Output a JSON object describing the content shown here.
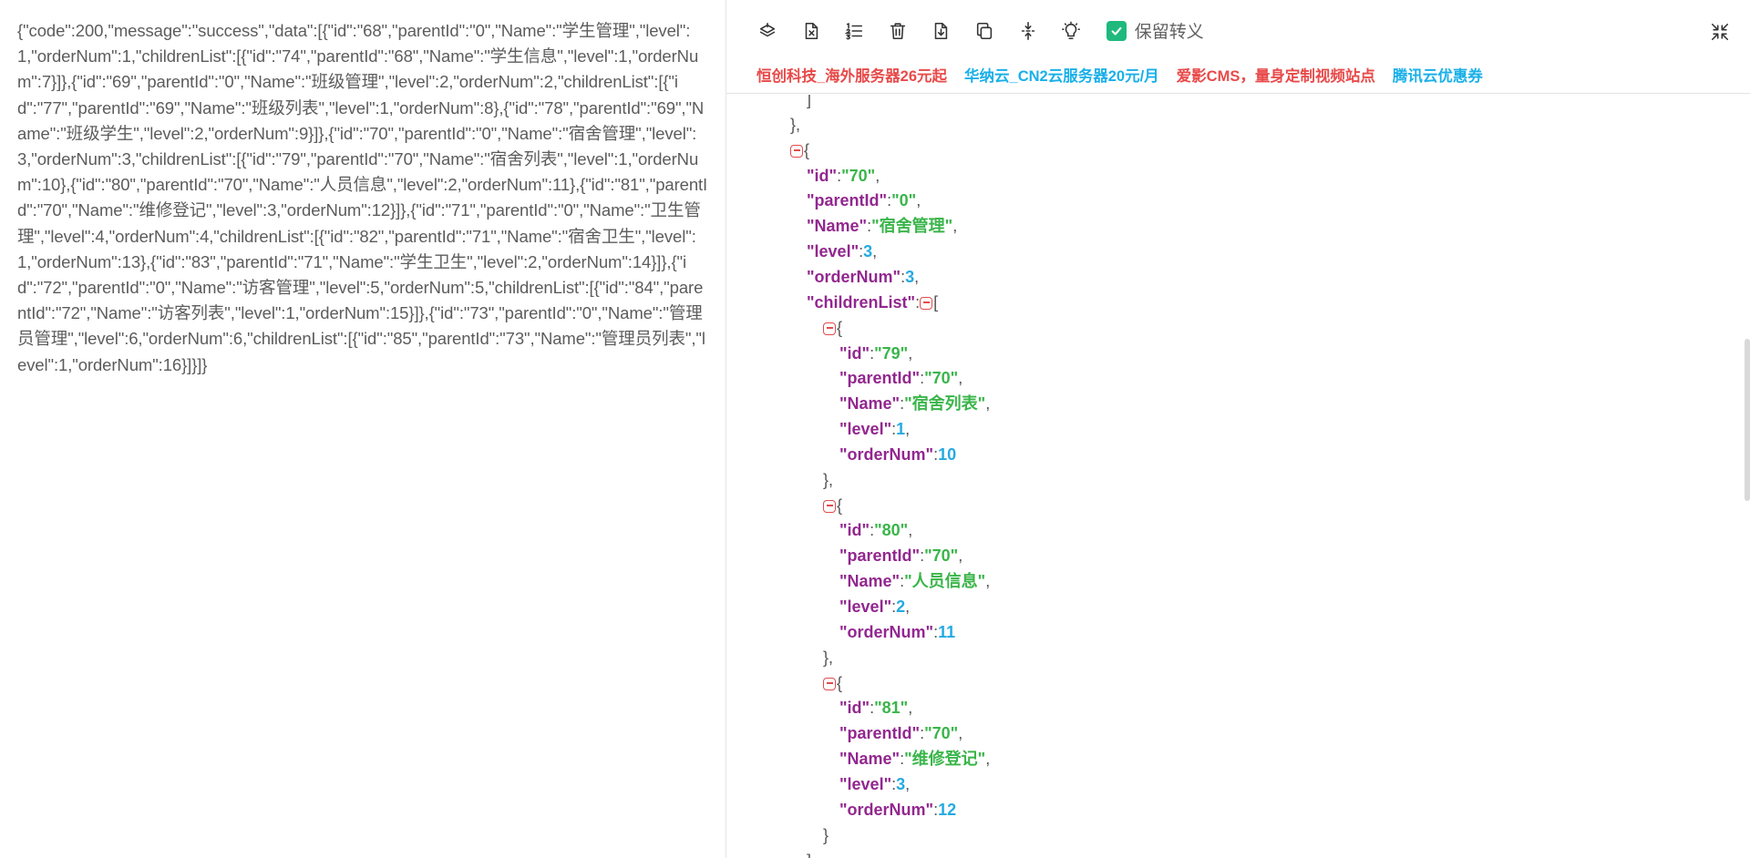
{
  "left_pane": {
    "raw_json": "{\"code\":200,\"message\":\"success\",\"data\":[{\"id\":\"68\",\"parentId\":\"0\",\"Name\":\"学生管理\",\"level\":1,\"orderNum\":1,\"childrenList\":[{\"id\":\"74\",\"parentId\":\"68\",\"Name\":\"学生信息\",\"level\":1,\"orderNum\":7}]},{\"id\":\"69\",\"parentId\":\"0\",\"Name\":\"班级管理\",\"level\":2,\"orderNum\":2,\"childrenList\":[{\"id\":\"77\",\"parentId\":\"69\",\"Name\":\"班级列表\",\"level\":1,\"orderNum\":8},{\"id\":\"78\",\"parentId\":\"69\",\"Name\":\"班级学生\",\"level\":2,\"orderNum\":9}]},{\"id\":\"70\",\"parentId\":\"0\",\"Name\":\"宿舍管理\",\"level\":3,\"orderNum\":3,\"childrenList\":[{\"id\":\"79\",\"parentId\":\"70\",\"Name\":\"宿舍列表\",\"level\":1,\"orderNum\":10},{\"id\":\"80\",\"parentId\":\"70\",\"Name\":\"人员信息\",\"level\":2,\"orderNum\":11},{\"id\":\"81\",\"parentId\":\"70\",\"Name\":\"维修登记\",\"level\":3,\"orderNum\":12}]},{\"id\":\"71\",\"parentId\":\"0\",\"Name\":\"卫生管理\",\"level\":4,\"orderNum\":4,\"childrenList\":[{\"id\":\"82\",\"parentId\":\"71\",\"Name\":\"宿舍卫生\",\"level\":1,\"orderNum\":13},{\"id\":\"83\",\"parentId\":\"71\",\"Name\":\"学生卫生\",\"level\":2,\"orderNum\":14}]},{\"id\":\"72\",\"parentId\":\"0\",\"Name\":\"访客管理\",\"level\":5,\"orderNum\":5,\"childrenList\":[{\"id\":\"84\",\"parentId\":\"72\",\"Name\":\"访客列表\",\"level\":1,\"orderNum\":15}]},{\"id\":\"73\",\"parentId\":\"0\",\"Name\":\"管理员管理\",\"level\":6,\"orderNum\":6,\"childrenList\":[{\"id\":\"85\",\"parentId\":\"73\",\"Name\":\"管理员列表\",\"level\":1,\"orderNum\":16}]}]}"
  },
  "toolbar": {
    "icons": [
      "layers-icon",
      "clear-file-icon",
      "ordered-list-icon",
      "delete-icon",
      "download-icon",
      "copy-icon",
      "compress-icon",
      "lightbulb-icon"
    ],
    "keep_escape_label": "保留转义",
    "keep_escape_checked": true,
    "collapse_icon": "collapse-arrows-icon"
  },
  "ads": [
    {
      "text": "恒创科技_海外服务器26元起",
      "color": "#e84a4a"
    },
    {
      "text": "华纳云_CN2云服务器20元/月",
      "color": "#1ab0e8"
    },
    {
      "text": "爱影CMS，量身定制视频站点",
      "color": "#e84a4a"
    },
    {
      "text": "腾讯云优惠券",
      "color": "#1ab0e8"
    }
  ],
  "colors": {
    "key": "#92278f",
    "string": "#3ab54a",
    "number": "#25aae1",
    "fold": "#e24b4b",
    "checkbox": "#1fb97d"
  },
  "tree_lines": [
    {
      "depth": 2,
      "tokens": [
        {
          "t": "p",
          "v": "]"
        }
      ]
    },
    {
      "depth": 1,
      "tokens": [
        {
          "t": "p",
          "v": "},"
        }
      ]
    },
    {
      "depth": 1,
      "tokens": [
        {
          "t": "fold"
        },
        {
          "t": "p",
          "v": "{"
        }
      ]
    },
    {
      "depth": 2,
      "tokens": [
        {
          "t": "k",
          "v": "\"id\""
        },
        {
          "t": "p",
          "v": ":"
        },
        {
          "t": "s",
          "v": "\"70\""
        },
        {
          "t": "p",
          "v": ","
        }
      ]
    },
    {
      "depth": 2,
      "tokens": [
        {
          "t": "k",
          "v": "\"parentId\""
        },
        {
          "t": "p",
          "v": ":"
        },
        {
          "t": "s",
          "v": "\"0\""
        },
        {
          "t": "p",
          "v": ","
        }
      ]
    },
    {
      "depth": 2,
      "tokens": [
        {
          "t": "k",
          "v": "\"Name\""
        },
        {
          "t": "p",
          "v": ":"
        },
        {
          "t": "s",
          "v": "\"宿舍管理\""
        },
        {
          "t": "p",
          "v": ","
        }
      ]
    },
    {
      "depth": 2,
      "tokens": [
        {
          "t": "k",
          "v": "\"level\""
        },
        {
          "t": "p",
          "v": ":"
        },
        {
          "t": "n",
          "v": "3"
        },
        {
          "t": "p",
          "v": ","
        }
      ]
    },
    {
      "depth": 2,
      "tokens": [
        {
          "t": "k",
          "v": "\"orderNum\""
        },
        {
          "t": "p",
          "v": ":"
        },
        {
          "t": "n",
          "v": "3"
        },
        {
          "t": "p",
          "v": ","
        }
      ]
    },
    {
      "depth": 2,
      "tokens": [
        {
          "t": "k",
          "v": "\"childrenList\""
        },
        {
          "t": "p",
          "v": ":"
        },
        {
          "t": "fold"
        },
        {
          "t": "p",
          "v": "["
        }
      ]
    },
    {
      "depth": 3,
      "tokens": [
        {
          "t": "fold"
        },
        {
          "t": "p",
          "v": "{"
        }
      ]
    },
    {
      "depth": 4,
      "tokens": [
        {
          "t": "k",
          "v": "\"id\""
        },
        {
          "t": "p",
          "v": ":"
        },
        {
          "t": "s",
          "v": "\"79\""
        },
        {
          "t": "p",
          "v": ","
        }
      ]
    },
    {
      "depth": 4,
      "tokens": [
        {
          "t": "k",
          "v": "\"parentId\""
        },
        {
          "t": "p",
          "v": ":"
        },
        {
          "t": "s",
          "v": "\"70\""
        },
        {
          "t": "p",
          "v": ","
        }
      ]
    },
    {
      "depth": 4,
      "tokens": [
        {
          "t": "k",
          "v": "\"Name\""
        },
        {
          "t": "p",
          "v": ":"
        },
        {
          "t": "s",
          "v": "\"宿舍列表\""
        },
        {
          "t": "p",
          "v": ","
        }
      ]
    },
    {
      "depth": 4,
      "tokens": [
        {
          "t": "k",
          "v": "\"level\""
        },
        {
          "t": "p",
          "v": ":"
        },
        {
          "t": "n",
          "v": "1"
        },
        {
          "t": "p",
          "v": ","
        }
      ]
    },
    {
      "depth": 4,
      "tokens": [
        {
          "t": "k",
          "v": "\"orderNum\""
        },
        {
          "t": "p",
          "v": ":"
        },
        {
          "t": "n",
          "v": "10"
        }
      ]
    },
    {
      "depth": 3,
      "tokens": [
        {
          "t": "p",
          "v": "},"
        }
      ]
    },
    {
      "depth": 3,
      "tokens": [
        {
          "t": "fold"
        },
        {
          "t": "p",
          "v": "{"
        }
      ]
    },
    {
      "depth": 4,
      "tokens": [
        {
          "t": "k",
          "v": "\"id\""
        },
        {
          "t": "p",
          "v": ":"
        },
        {
          "t": "s",
          "v": "\"80\""
        },
        {
          "t": "p",
          "v": ","
        }
      ]
    },
    {
      "depth": 4,
      "tokens": [
        {
          "t": "k",
          "v": "\"parentId\""
        },
        {
          "t": "p",
          "v": ":"
        },
        {
          "t": "s",
          "v": "\"70\""
        },
        {
          "t": "p",
          "v": ","
        }
      ]
    },
    {
      "depth": 4,
      "tokens": [
        {
          "t": "k",
          "v": "\"Name\""
        },
        {
          "t": "p",
          "v": ":"
        },
        {
          "t": "s",
          "v": "\"人员信息\""
        },
        {
          "t": "p",
          "v": ","
        }
      ]
    },
    {
      "depth": 4,
      "tokens": [
        {
          "t": "k",
          "v": "\"level\""
        },
        {
          "t": "p",
          "v": ":"
        },
        {
          "t": "n",
          "v": "2"
        },
        {
          "t": "p",
          "v": ","
        }
      ]
    },
    {
      "depth": 4,
      "tokens": [
        {
          "t": "k",
          "v": "\"orderNum\""
        },
        {
          "t": "p",
          "v": ":"
        },
        {
          "t": "n",
          "v": "11"
        }
      ]
    },
    {
      "depth": 3,
      "tokens": [
        {
          "t": "p",
          "v": "},"
        }
      ]
    },
    {
      "depth": 3,
      "tokens": [
        {
          "t": "fold"
        },
        {
          "t": "p",
          "v": "{"
        }
      ]
    },
    {
      "depth": 4,
      "tokens": [
        {
          "t": "k",
          "v": "\"id\""
        },
        {
          "t": "p",
          "v": ":"
        },
        {
          "t": "s",
          "v": "\"81\""
        },
        {
          "t": "p",
          "v": ","
        }
      ]
    },
    {
      "depth": 4,
      "tokens": [
        {
          "t": "k",
          "v": "\"parentId\""
        },
        {
          "t": "p",
          "v": ":"
        },
        {
          "t": "s",
          "v": "\"70\""
        },
        {
          "t": "p",
          "v": ","
        }
      ]
    },
    {
      "depth": 4,
      "tokens": [
        {
          "t": "k",
          "v": "\"Name\""
        },
        {
          "t": "p",
          "v": ":"
        },
        {
          "t": "s",
          "v": "\"维修登记\""
        },
        {
          "t": "p",
          "v": ","
        }
      ]
    },
    {
      "depth": 4,
      "tokens": [
        {
          "t": "k",
          "v": "\"level\""
        },
        {
          "t": "p",
          "v": ":"
        },
        {
          "t": "n",
          "v": "3"
        },
        {
          "t": "p",
          "v": ","
        }
      ]
    },
    {
      "depth": 4,
      "tokens": [
        {
          "t": "k",
          "v": "\"orderNum\""
        },
        {
          "t": "p",
          "v": ":"
        },
        {
          "t": "n",
          "v": "12"
        }
      ]
    },
    {
      "depth": 3,
      "tokens": [
        {
          "t": "p",
          "v": "}"
        }
      ]
    },
    {
      "depth": 2,
      "tokens": [
        {
          "t": "p",
          "v": "]"
        }
      ]
    }
  ]
}
